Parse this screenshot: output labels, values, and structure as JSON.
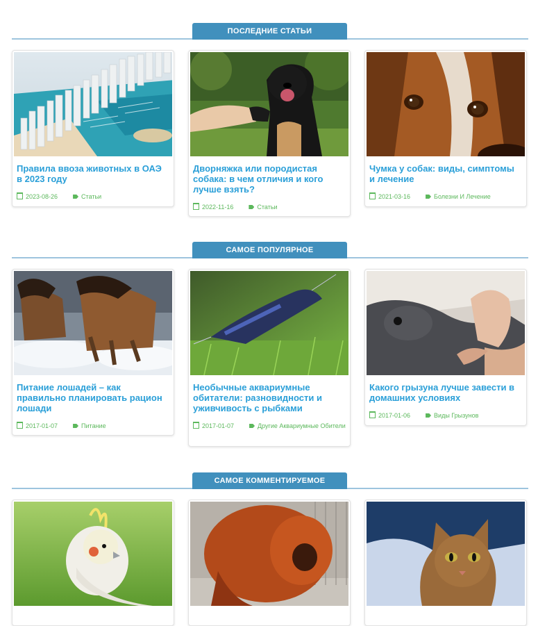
{
  "sections": [
    {
      "title": "ПОСЛЕДНИЕ СТАТЬИ",
      "cards": [
        {
          "title": "Правила ввоза животных в ОАЭ в 2023 году",
          "date": "2023-08-26",
          "category": "Статьи",
          "image": "dubai-marina-aerial"
        },
        {
          "title": "Дворняжка или породистая собака: в чем отличия и кого лучше взять?",
          "date": "2022-11-16",
          "category": "Статьи",
          "image": "black-dog-giving-paw"
        },
        {
          "title": "Чумка у собак: виды, симптомы и лечение",
          "date": "2021-03-16",
          "category": "Болезни И Лечение",
          "image": "beagle-closeup"
        }
      ]
    },
    {
      "title": "САМОЕ ПОПУЛЯРНОЕ",
      "cards": [
        {
          "title": "Питание лошадей – как правильно планировать рацион лошади",
          "date": "2017-01-07",
          "category": "Питание",
          "image": "horses-running-snow"
        },
        {
          "title": "Необычные аквариумные обитатели: разновидности и уживчивость с рыбками",
          "date": "2017-01-07",
          "category": "Другие Аквариумные Обители",
          "image": "blue-shrimp-aquarium"
        },
        {
          "title": "Какого грызуна лучше завести в домашних условиях",
          "date": "2017-01-06",
          "category": "Виды Грызунов",
          "image": "chinchilla-in-hand"
        }
      ]
    },
    {
      "title": "САМОЕ КОММЕНТИРУЕМОЕ",
      "cards": [
        {
          "image": "cockatiel-parrot"
        },
        {
          "image": "tibetan-mastiff"
        },
        {
          "image": "abyssinian-cat"
        }
      ]
    }
  ],
  "icons": {
    "date": "calendar-icon",
    "category": "tag-icon"
  },
  "colors": {
    "accent": "#4190bd",
    "title_link": "#2a9fd8",
    "meta": "#5cb85c",
    "rule": "#9dc4de"
  }
}
